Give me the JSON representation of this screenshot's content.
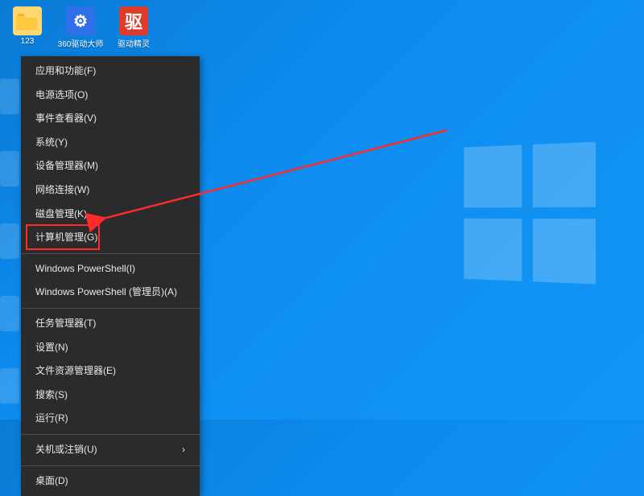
{
  "desktop": {
    "icons": [
      {
        "id": "folder-123",
        "label": "123",
        "type": "folder"
      },
      {
        "id": "360-drv",
        "label": "360驱动大师",
        "type": "blue",
        "glyph": "⚙"
      },
      {
        "id": "drv-genius",
        "label": "驱动精灵",
        "type": "red",
        "glyph": "驱"
      }
    ]
  },
  "contextMenu": {
    "groups": [
      [
        {
          "id": "apps-features",
          "label": "应用和功能(F)"
        },
        {
          "id": "power-options",
          "label": "电源选项(O)"
        },
        {
          "id": "event-viewer",
          "label": "事件查看器(V)"
        },
        {
          "id": "system",
          "label": "系统(Y)"
        },
        {
          "id": "device-manager",
          "label": "设备管理器(M)"
        },
        {
          "id": "network-conn",
          "label": "网络连接(W)"
        },
        {
          "id": "disk-mgmt",
          "label": "磁盘管理(K)"
        },
        {
          "id": "computer-mgmt",
          "label": "计算机管理(G)",
          "highlighted": true
        }
      ],
      [
        {
          "id": "ps",
          "label": "Windows PowerShell(I)"
        },
        {
          "id": "ps-admin",
          "label": "Windows PowerShell (管理员)(A)"
        }
      ],
      [
        {
          "id": "task-mgr",
          "label": "任务管理器(T)"
        },
        {
          "id": "settings",
          "label": "设置(N)"
        },
        {
          "id": "file-explorer",
          "label": "文件资源管理器(E)"
        },
        {
          "id": "search",
          "label": "搜索(S)"
        },
        {
          "id": "run",
          "label": "运行(R)"
        }
      ],
      [
        {
          "id": "shutdown",
          "label": "关机或注销(U)",
          "submenu": true
        }
      ],
      [
        {
          "id": "desktop",
          "label": "桌面(D)"
        }
      ]
    ]
  },
  "annotation": {
    "highlightedItem": "computer-mgmt",
    "arrowColor": "#ff2a2a"
  }
}
